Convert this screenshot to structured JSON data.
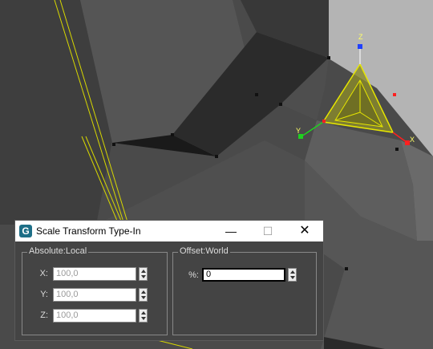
{
  "dialog": {
    "title": "Scale Transform Type-In",
    "app_icon_letter": "G",
    "minimize_glyph": "—",
    "maximize_glyph": "☐",
    "close_glyph": "✕",
    "absolute": {
      "label": "Absolute:Local",
      "fields": [
        {
          "label": "X:",
          "value": "100,0"
        },
        {
          "label": "Y:",
          "value": "100,0"
        },
        {
          "label": "Z:",
          "value": "100,0"
        }
      ]
    },
    "offset": {
      "label": "Offset:World",
      "field_label": "%:",
      "value": "0"
    }
  },
  "viewport": {
    "axis_labels": {
      "z": "Z",
      "y": "Y",
      "x": "X"
    },
    "colors": {
      "background": "#4a4a4a",
      "gizmo_yellow": "#e6e600",
      "axis_x": "#ff2020",
      "axis_y": "#20d020",
      "axis_z": "#2040ff"
    }
  },
  "icons": [
    "app-icon",
    "minimize-icon",
    "maximize-icon",
    "close-icon",
    "spinner-icon"
  ]
}
